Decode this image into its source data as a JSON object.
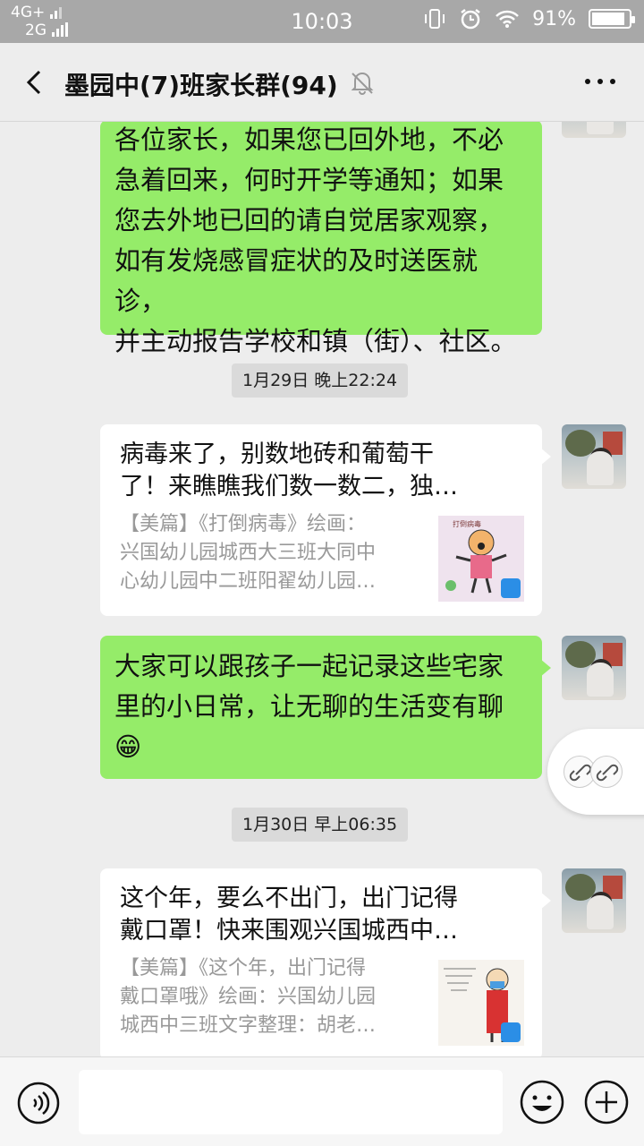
{
  "status_bar": {
    "net_top": "4G+",
    "net_bottom": "2G",
    "time": "10:03",
    "battery_pct": "91%",
    "battery_level": 0.91
  },
  "nav": {
    "title": "墨园中(7)班家长群(94)"
  },
  "messages": [
    {
      "type": "text",
      "side": "right",
      "text": "各位家长，如果您已回外地，不必\n急着回来，何时开学等通知；如果\n您去外地已回的请自觉居家观察，\n如有发烧感冒症状的及时送医就诊，\n并主动报告学校和镇（街）、社区。"
    },
    {
      "type": "time",
      "text": "1月29日 晚上22:24"
    },
    {
      "type": "card",
      "title": "病毒来了，别数地砖和葡萄干\n了！来瞧瞧我们数一数二，独…",
      "desc": "【美篇】《打倒病毒》绘画：\n兴国幼儿园城西大三班大同中\n心幼儿园中二班阳翟幼儿园…",
      "thumb_icon": "drawing-thumbnail"
    },
    {
      "type": "text",
      "side": "right",
      "text": "大家可以跟孩子一起记录这些宅家\n里的小日常，让无聊的生活变有聊\n😁"
    },
    {
      "type": "time",
      "text": "1月30日 早上06:35"
    },
    {
      "type": "card",
      "title": "这个年，要么不出门，出门记得\n戴口罩！快来围观兴国城西中…",
      "desc": "【美篇】《这个年，出门记得\n戴口罩哦》绘画：兴国幼儿园\n城西中三班文字整理：胡老…",
      "thumb_icon": "mask-drawing-thumbnail"
    }
  ],
  "colors": {
    "green_bubble": "#95ec69",
    "chat_bg": "#ededed",
    "status_bg": "#a8a8a8"
  }
}
